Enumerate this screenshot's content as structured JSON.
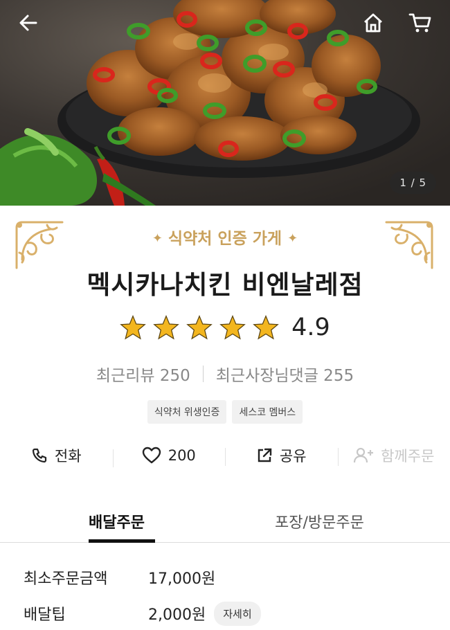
{
  "hero": {
    "image_counter": "1 / 5",
    "back_icon": "back-arrow-icon",
    "home_icon": "home-icon",
    "cart_icon": "cart-icon"
  },
  "store": {
    "certification": "식약처 인증 가게",
    "name": "멕시카나치킨 비엔날레점",
    "rating": "4.9",
    "star_count": 5,
    "recent_reviews": "최근리뷰 250",
    "owner_comments": "최근사장님댓글 255",
    "badges": [
      "식약처 위생인증",
      "세스코 멤버스"
    ]
  },
  "actions": {
    "call": "전화",
    "like_count": "200",
    "share": "공유",
    "group_order": "함께주문"
  },
  "tabs": {
    "delivery": "배달주문",
    "pickup": "포장/방문주문"
  },
  "order_info": {
    "min_order_label": "최소주문금액",
    "min_order_value": "17,000원",
    "delivery_tip_label": "배달팁",
    "delivery_tip_value": "2,000원",
    "detail_button": "자세히"
  },
  "colors": {
    "gold": "#c9a15c",
    "star": "#f3b61f",
    "tab_active": "#111111"
  }
}
